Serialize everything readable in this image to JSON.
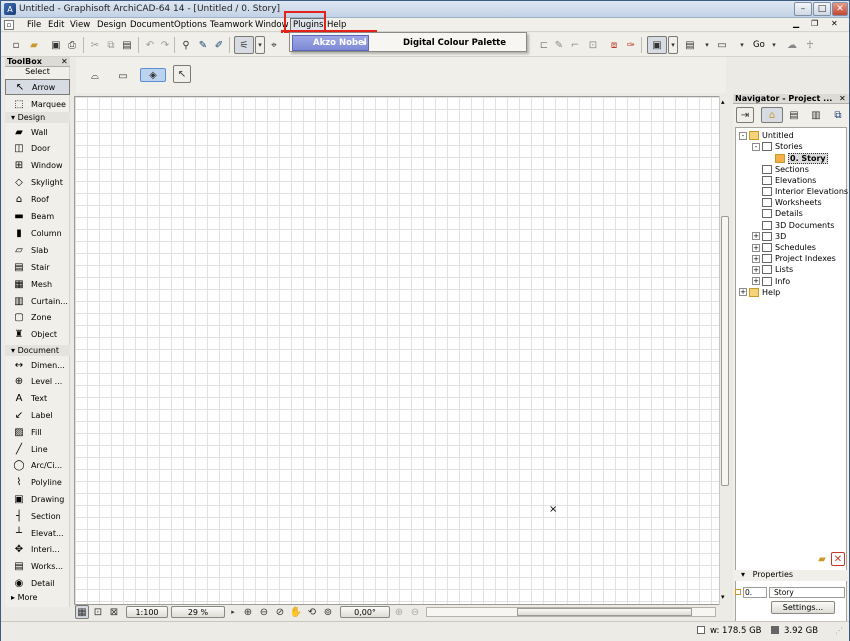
{
  "window": {
    "title": "Untitled - Graphisoft ArchiCAD-64 14 - [Untitled / 0. Story]",
    "min": "–",
    "max": "□",
    "close": "✕"
  },
  "menu": [
    "File",
    "Edit",
    "View",
    "Design",
    "Document",
    "Options",
    "Teamwork",
    "Window",
    "Plugins",
    "Help"
  ],
  "plugins_menu": {
    "item": "Akzo Nobel",
    "arrow": "▸",
    "submenu_item": "Digital Colour Palette"
  },
  "toolbar": {
    "go_label": "Go"
  },
  "toolbox": {
    "title": "ToolBox",
    "close": "✕",
    "select_label": "Select",
    "pointer_tools": [
      {
        "label": "Arrow",
        "icon": "↖"
      },
      {
        "label": "Marquee",
        "icon": "⬚"
      }
    ],
    "design_header": "Design",
    "design_tools": [
      {
        "label": "Wall",
        "icon": "▰"
      },
      {
        "label": "Door",
        "icon": "◫"
      },
      {
        "label": "Window",
        "icon": "⊞"
      },
      {
        "label": "Skylight",
        "icon": "◇"
      },
      {
        "label": "Roof",
        "icon": "⌂"
      },
      {
        "label": "Beam",
        "icon": "▬"
      },
      {
        "label": "Column",
        "icon": "▮"
      },
      {
        "label": "Slab",
        "icon": "▱"
      },
      {
        "label": "Stair",
        "icon": "▤"
      },
      {
        "label": "Mesh",
        "icon": "▦"
      },
      {
        "label": "Curtain...",
        "icon": "▥"
      },
      {
        "label": "Zone",
        "icon": "▢"
      },
      {
        "label": "Object",
        "icon": "♜"
      }
    ],
    "document_header": "Document",
    "document_tools": [
      {
        "label": "Dimen...",
        "icon": "↔"
      },
      {
        "label": "Level ...",
        "icon": "⊕"
      },
      {
        "label": "Text",
        "icon": "A"
      },
      {
        "label": "Label",
        "icon": "↙"
      },
      {
        "label": "Fill",
        "icon": "▨"
      },
      {
        "label": "Line",
        "icon": "╱"
      },
      {
        "label": "Arc/Ci...",
        "icon": "◯"
      },
      {
        "label": "Polyline",
        "icon": "⌇"
      },
      {
        "label": "Drawing",
        "icon": "▣"
      },
      {
        "label": "Section",
        "icon": "┤"
      },
      {
        "label": "Elevat...",
        "icon": "┴"
      },
      {
        "label": "Interi...",
        "icon": "✥"
      },
      {
        "label": "Works...",
        "icon": "▤"
      },
      {
        "label": "Detail",
        "icon": "◉"
      }
    ],
    "more_label": "More"
  },
  "canvas": {
    "scale": "1:100",
    "zoom": "29 %",
    "angle": "0,00°",
    "origin_mark": "×"
  },
  "navigator": {
    "title": "Navigator - Project ...",
    "close": "✕",
    "tree": [
      {
        "label": "Untitled",
        "level": 0,
        "expander": "-"
      },
      {
        "label": "Stories",
        "level": 1,
        "expander": "-"
      },
      {
        "label": "0. Story",
        "level": 2,
        "expander": "",
        "selected": true
      },
      {
        "label": "Sections",
        "level": 1,
        "expander": ""
      },
      {
        "label": "Elevations",
        "level": 1,
        "expander": ""
      },
      {
        "label": "Interior Elevations",
        "level": 1,
        "expander": ""
      },
      {
        "label": "Worksheets",
        "level": 1,
        "expander": ""
      },
      {
        "label": "Details",
        "level": 1,
        "expander": ""
      },
      {
        "label": "3D Documents",
        "level": 1,
        "expander": ""
      },
      {
        "label": "3D",
        "level": 1,
        "expander": "+"
      },
      {
        "label": "Schedules",
        "level": 1,
        "expander": "+"
      },
      {
        "label": "Project Indexes",
        "level": 1,
        "expander": "+"
      },
      {
        "label": "Lists",
        "level": 1,
        "expander": "+"
      },
      {
        "label": "Info",
        "level": 1,
        "expander": "+"
      },
      {
        "label": "Help",
        "level": 0,
        "expander": "+"
      }
    ],
    "properties_label": "Properties",
    "prop_id": "0.",
    "prop_name": "Story",
    "settings_label": "Settings..."
  },
  "status": {
    "disk": "w: 178.5 GB",
    "ram": "3.92 GB"
  },
  "colors": {
    "accent": "#7e8ad6",
    "highlight_box": "#e3231b",
    "selected_tree": "#dcdcdc"
  }
}
